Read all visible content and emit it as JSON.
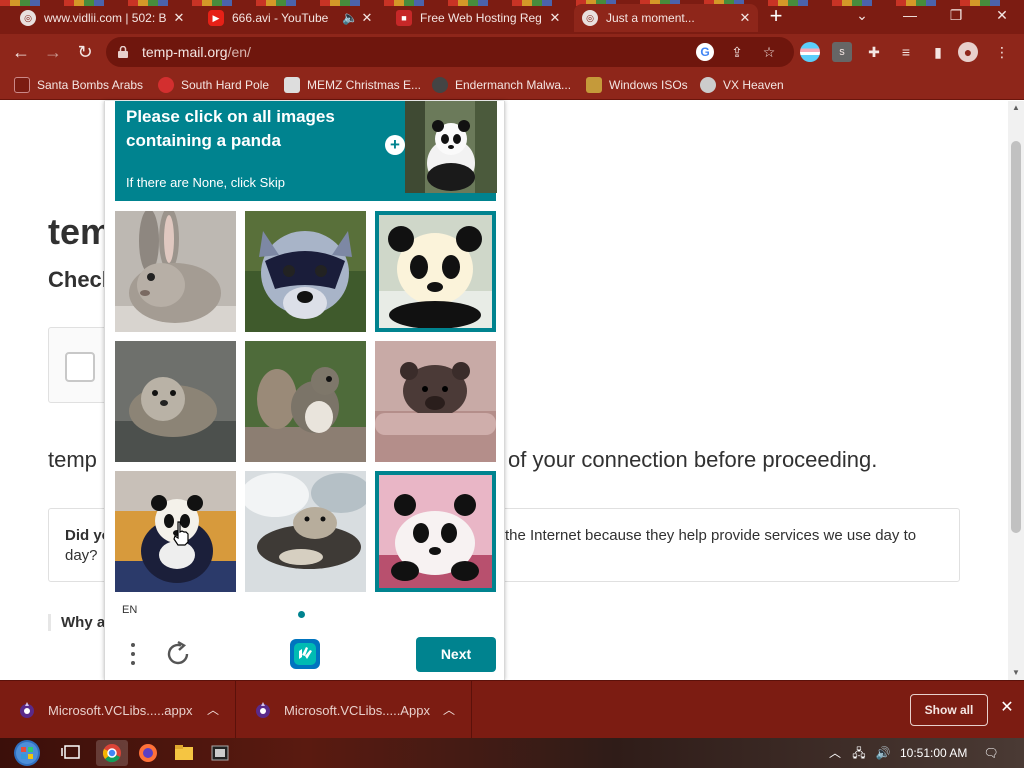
{
  "browser": {
    "tabs": [
      {
        "title": "www.vidlii.com | 502: B",
        "favicon": "globe-icon"
      },
      {
        "title": "666.avi - YouTube",
        "favicon": "youtube-icon"
      },
      {
        "title": "Free Web Hosting Reg",
        "favicon": "hosting-icon"
      },
      {
        "title": "Just a moment...",
        "favicon": "globe-icon"
      }
    ],
    "url_host": "temp-mail.org",
    "url_path": "/en/",
    "bookmarks": [
      "Santa Bombs Arabs",
      "South Hard Pole",
      "MEMZ Christmas E...",
      "Endermanch Malwa...",
      "Windows ISOs",
      "VX Heaven"
    ]
  },
  "page": {
    "heading": "tem",
    "subheading": "Check",
    "connection_left": "temp",
    "connection_right": "of your connection before proceeding.",
    "info_left_bold": "Did yo",
    "info_left_line2": "day?",
    "info_right": "the Internet because they help provide services we use day to",
    "why": "Why a"
  },
  "captcha": {
    "prompt": "Please click on all images containing a panda",
    "prompt_sub": "If there are None, click Skip",
    "language": "EN",
    "next_label": "Next",
    "tiles": [
      {
        "subject": "rabbit",
        "selected": false
      },
      {
        "subject": "raccoon",
        "selected": false
      },
      {
        "subject": "panda",
        "selected": true
      },
      {
        "subject": "otter",
        "selected": false
      },
      {
        "subject": "squirrel",
        "selected": false
      },
      {
        "subject": "bear",
        "selected": false
      },
      {
        "subject": "panda",
        "selected": false
      },
      {
        "subject": "otter",
        "selected": false
      },
      {
        "subject": "panda",
        "selected": true
      }
    ]
  },
  "downloads": [
    {
      "name": "Microsoft.VCLibs.....appx"
    },
    {
      "name": "Microsoft.VCLibs.....Appx"
    }
  ],
  "show_all": "Show all",
  "taskbar": {
    "clock": "10:51:00 AM"
  },
  "colors": {
    "accent": "#00838f",
    "chrome": "#8e261a"
  }
}
